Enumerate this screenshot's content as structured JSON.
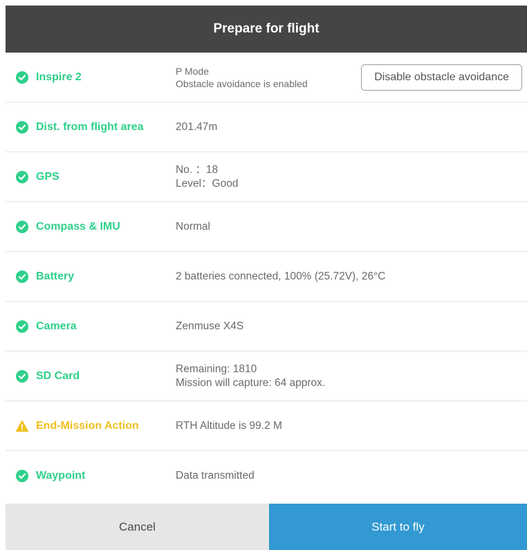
{
  "header": {
    "title": "Prepare for flight"
  },
  "colors": {
    "ok": "#2ed08a",
    "warning": "#f0bf1d",
    "header_bg": "#454545",
    "primary": "#3299d3",
    "secondary_bg": "#e6e6e6"
  },
  "rows": [
    {
      "status": "ok",
      "icon": "check-circle-icon",
      "label": "Inspire 2",
      "lines": [
        "P Mode",
        "Obstacle avoidance is enabled"
      ],
      "action_label": "Disable obstacle avoidance"
    },
    {
      "status": "ok",
      "icon": "check-circle-icon",
      "label": "Dist. from flight area",
      "lines": [
        "201.47m"
      ]
    },
    {
      "status": "ok",
      "icon": "check-circle-icon",
      "label": "GPS",
      "lines": [
        "No. ：18",
        "Level：Good"
      ]
    },
    {
      "status": "ok",
      "icon": "check-circle-icon",
      "label": "Compass & IMU",
      "lines": [
        "Normal"
      ]
    },
    {
      "status": "ok",
      "icon": "check-circle-icon",
      "label": "Battery",
      "lines": [
        "2 batteries connected, 100% (25.72V), 26°C"
      ]
    },
    {
      "status": "ok",
      "icon": "check-circle-icon",
      "label": "Camera",
      "lines": [
        "Zenmuse X4S"
      ]
    },
    {
      "status": "ok",
      "icon": "check-circle-icon",
      "label": "SD Card",
      "lines": [
        "Remaining: 1810",
        "Mission will capture: 64 approx."
      ]
    },
    {
      "status": "warning",
      "icon": "warning-triangle-icon",
      "label": "End-Mission Action",
      "lines": [
        "RTH Altitude is 99.2 M"
      ]
    },
    {
      "status": "ok",
      "icon": "check-circle-icon",
      "label": "Waypoint",
      "lines": [
        "Data transmitted"
      ]
    }
  ],
  "footer": {
    "cancel_label": "Cancel",
    "start_label": "Start to fly"
  }
}
